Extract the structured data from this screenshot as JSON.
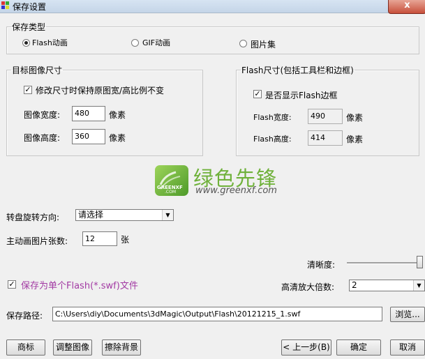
{
  "window": {
    "title": "保存设置",
    "close_label": "x"
  },
  "save_type": {
    "legend": "保存类型",
    "options": [
      {
        "label": "Flash动画",
        "selected": true
      },
      {
        "label": "GIF动画",
        "selected": false
      },
      {
        "label": "图片集",
        "selected": false
      }
    ]
  },
  "target_size": {
    "legend": "目标图像尺寸",
    "keep_ratio_label": "修改尺寸时保持原图宽/高比例不变",
    "keep_ratio_checked": true,
    "width_label": "图像宽度:",
    "width_value": "480",
    "width_unit": "像素",
    "height_label": "图像高度:",
    "height_value": "360",
    "height_unit": "像素"
  },
  "flash_size": {
    "legend": "Flash尺寸(包括工具栏和边框)",
    "show_border_label": "是否显示Flash边框",
    "show_border_checked": true,
    "width_label": "Flash宽度:",
    "width_value": "490",
    "width_unit": "像素",
    "height_label": "Flash高度:",
    "height_value": "414",
    "height_unit": "像素"
  },
  "watermark": {
    "brand": "绿色先锋",
    "url": "www.greenxf.com",
    "logo_text": "GREENXF",
    "logo_sub": ".COM"
  },
  "rotation": {
    "label": "转盘旋转方向:",
    "value": "请选择"
  },
  "frames": {
    "label": "主动画图片张数:",
    "value": "12",
    "unit": "张"
  },
  "clarity": {
    "label": "清晰度:",
    "level": 1.0
  },
  "single_flash": {
    "label": "保存为单个Flash(*.swf)文件",
    "checked": true
  },
  "zoom": {
    "label": "高清放大倍数:",
    "value": "2"
  },
  "save_path": {
    "label": "保存路径:",
    "value": "C:\\Users\\diy\\Documents\\3dMagic\\Output\\Flash\\20121215_1.swf",
    "browse_label": "浏览..."
  },
  "buttons": {
    "trademark": "商标",
    "adjust_image": "调整图像",
    "remove_background": "擦除背景",
    "prev": "< 上一步(B)",
    "ok": "确定",
    "cancel": "取消"
  },
  "colors": {
    "accent_text": "#a23aa3",
    "brand_green": "#6fb13a"
  }
}
